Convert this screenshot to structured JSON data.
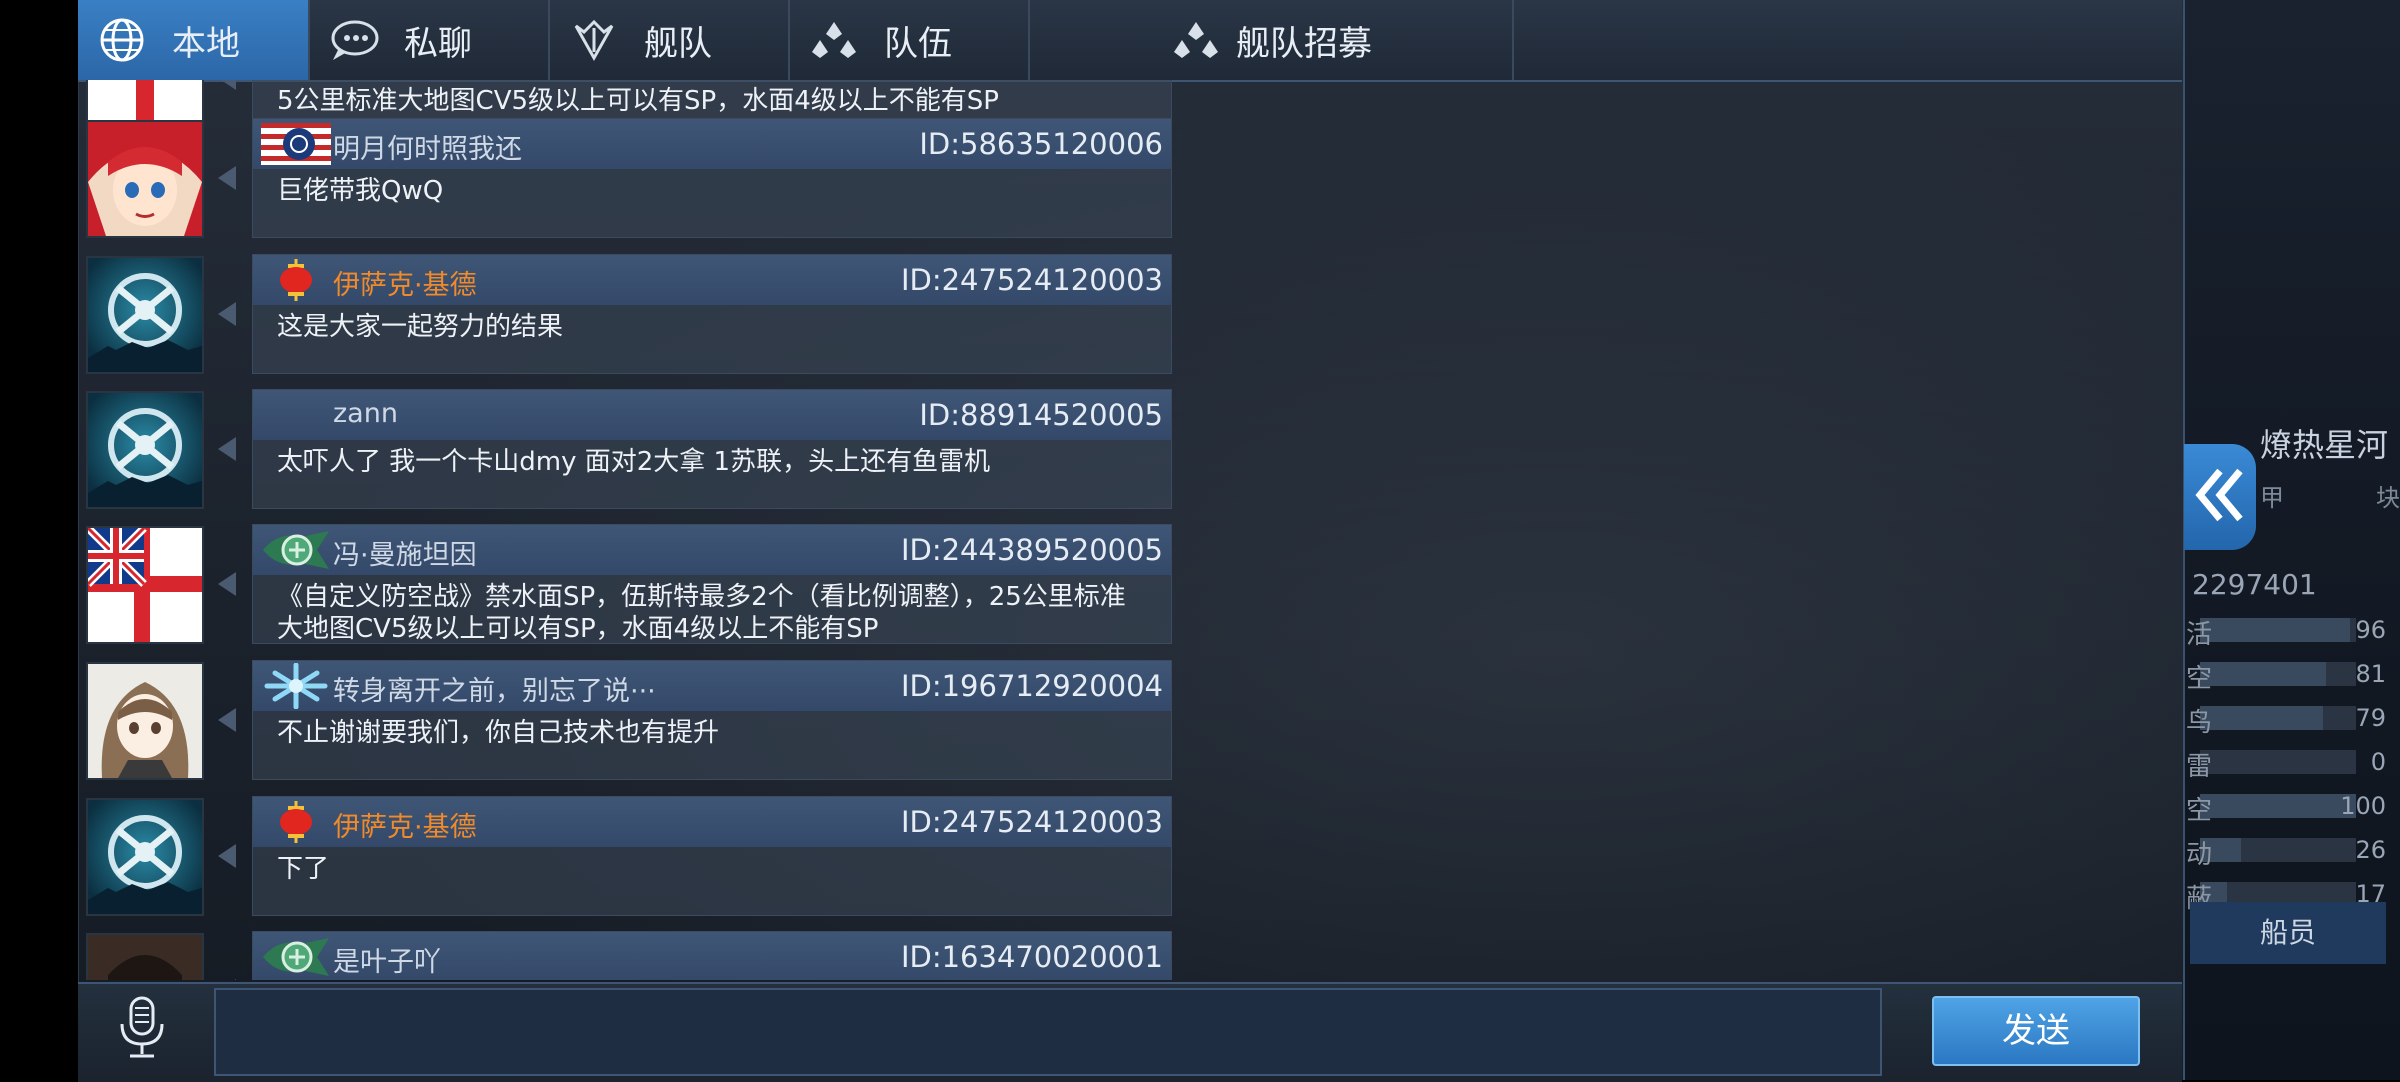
{
  "tabs": [
    {
      "label": "本地",
      "icon": "globe-icon",
      "active": true
    },
    {
      "label": "私聊",
      "icon": "chat-bubble-icon",
      "active": false
    },
    {
      "label": "舰队",
      "icon": "fleet-icon",
      "active": false
    },
    {
      "label": "队伍",
      "icon": "team-icon",
      "active": false
    },
    {
      "label": "舰队招募",
      "icon": "team-icon",
      "active": false
    }
  ],
  "messages": [
    {
      "sender": "",
      "sender_color": "#cfd9e6",
      "uid": "",
      "text": "5公里标准大地图CV5级以上可以有SP，水面4级以上不能有SP",
      "avatar": "flag-white-red-cross",
      "badge": ""
    },
    {
      "sender": "明月何时照我还",
      "sender_color": "#cfd9e6",
      "uid": "ID:58635120006",
      "text": "巨佬带我QwQ",
      "avatar": "anime-red-hair-girl",
      "badge": "us-flag-badge"
    },
    {
      "sender": "伊萨克·基德",
      "sender_color": "#f08a2a",
      "uid": "ID:247524120003",
      "text": "这是大家一起努力的结果",
      "avatar": "navy-emblem",
      "badge": "lantern-badge"
    },
    {
      "sender": "zann",
      "sender_color": "#cfd9e6",
      "uid": "ID:88914520005",
      "text": "太吓人了 我一个卡山dmy 面对2大拿 1苏联，头上还有鱼雷机",
      "avatar": "navy-emblem",
      "badge": ""
    },
    {
      "sender": "冯·曼施坦因",
      "sender_color": "#cfd9e6",
      "uid": "ID:244389520005",
      "text": "《自定义防空战》禁水面SP，伍斯特最多2个（看比例调整），25公里标准大地图CV5级以上可以有SP，水面4级以上不能有SP",
      "avatar": "flag-white-ensign",
      "badge": "green-emblem-badge"
    },
    {
      "sender": "转身离开之前，别忘了说···",
      "sender_color": "#cfd9e6",
      "uid": "ID:196712920004",
      "text": "不止谢谢要我们，你自己技术也有提升",
      "avatar": "anime-brown-hair-girl",
      "badge": "snowflake-badge"
    },
    {
      "sender": "伊萨克·基德",
      "sender_color": "#f08a2a",
      "uid": "ID:247524120003",
      "text": "下了",
      "avatar": "navy-emblem",
      "badge": "lantern-badge"
    },
    {
      "sender": "是叶子吖",
      "sender_color": "#cfd9e6",
      "uid": "ID:163470020001",
      "text": "",
      "avatar": "dark-portrait",
      "badge": "green-emblem-badge"
    }
  ],
  "input": {
    "value": "",
    "placeholder": ""
  },
  "send_label": "发送",
  "mic_icon": "microphone-icon",
  "collapse_icon": "double-chevron-left-icon",
  "background_panel": {
    "username": "燎热星河",
    "uid": "2297401",
    "side_labels": [
      "甲",
      "块"
    ],
    "stats": [
      {
        "label": "活",
        "value": "96",
        "fill": 0.96
      },
      {
        "label": "空",
        "value": "81",
        "fill": 0.81
      },
      {
        "label": "鸟",
        "value": "79",
        "fill": 0.79
      },
      {
        "label": "雷",
        "value": "0",
        "fill": 0.0
      },
      {
        "label": "空",
        "value": "100",
        "fill": 1.0
      },
      {
        "label": "动",
        "value": "26",
        "fill": 0.26
      },
      {
        "label": "蔽",
        "value": "17",
        "fill": 0.17
      }
    ],
    "crew_label": "船员"
  },
  "colors": {
    "accent": "#2b78c2",
    "orange_name": "#f08a2a",
    "panel": "#1c232d"
  }
}
